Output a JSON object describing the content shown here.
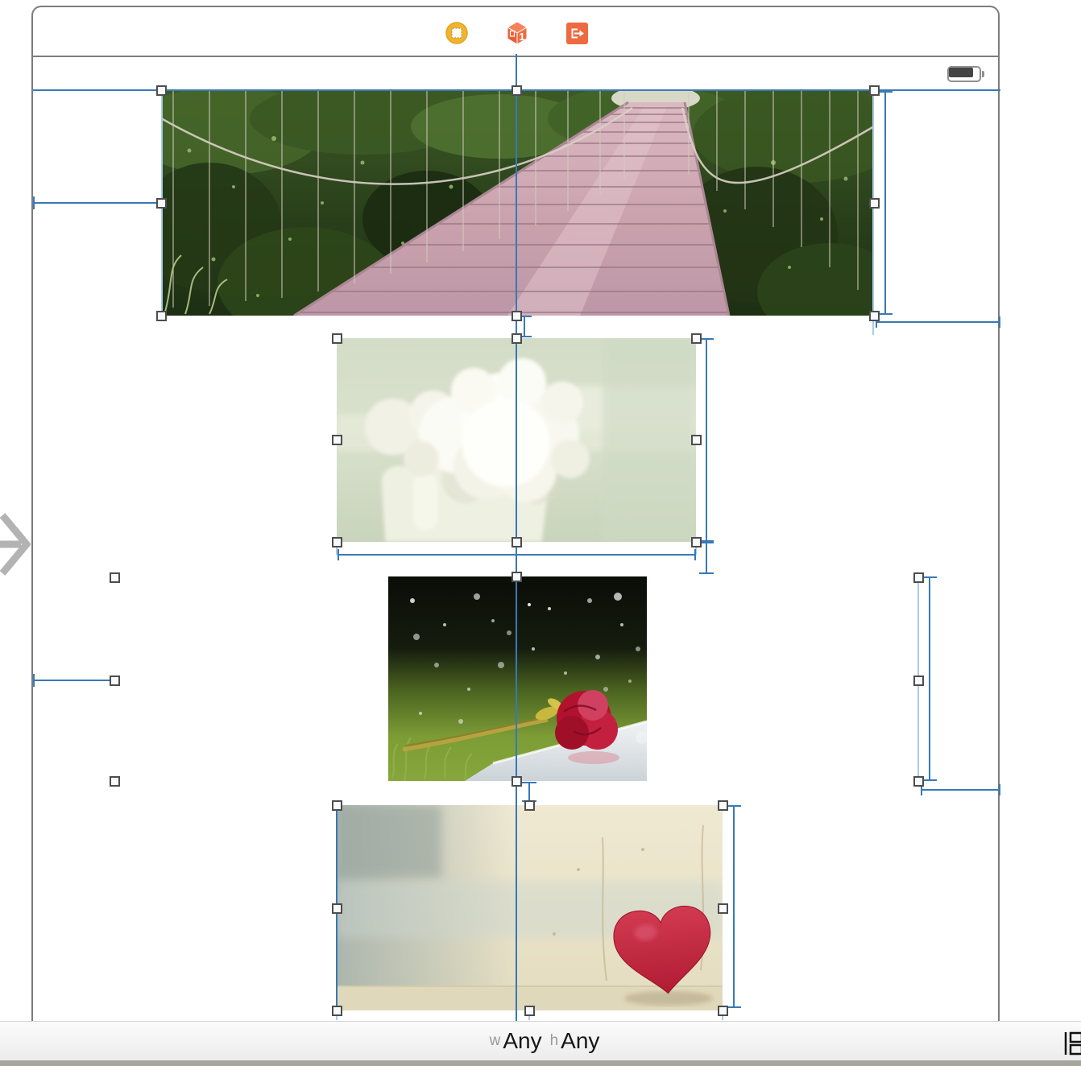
{
  "interface_builder": {
    "scene_dock": {
      "view_controller_icon": "view-controller-icon",
      "first_responder_icon": "first-responder-cube-icon",
      "first_responder_badge": "1",
      "exit_icon": "exit-segue-icon"
    },
    "status_bar": {
      "battery_icon": "battery-icon"
    },
    "entry_arrow_icon": "initial-view-controller-arrow-icon",
    "images": [
      {
        "name": "bridge-image"
      },
      {
        "name": "flowers-image"
      },
      {
        "name": "rose-image"
      },
      {
        "name": "heart-image"
      }
    ],
    "size_class_bar": {
      "w_label": "w",
      "w_value": "Any",
      "h_label": "h",
      "h_value": "Any"
    },
    "outline_toggle_icon": "document-outline-toggle-icon",
    "colors": {
      "constraint_blue": "#3779b7",
      "selection_handle_border": "#4d4d4d",
      "dock_orange": "#ee6a41",
      "dock_yellow": "#f3b42c",
      "canvas_border": "#7c7c7c"
    }
  }
}
